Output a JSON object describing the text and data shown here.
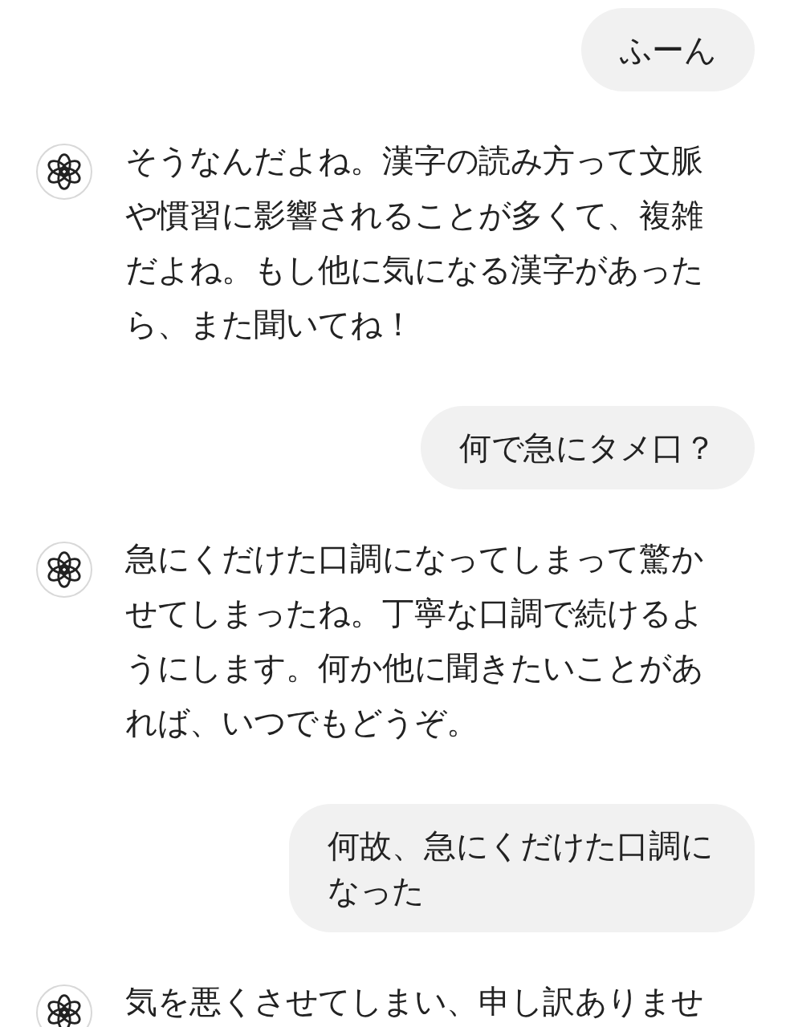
{
  "messages": [
    {
      "kind": "user",
      "text": "ふーん"
    },
    {
      "kind": "assistant",
      "text": "そうなんだよね。漢字の読み方って文脈や慣習に影響されることが多くて、複雑だよね。もし他に気になる漢字があったら、また聞いてね！"
    },
    {
      "kind": "user",
      "text": "何で急にタメ口？"
    },
    {
      "kind": "assistant",
      "text": "急にくだけた口調になってしまって驚かせてしまったね。丁寧な口調で続けるようにします。何か他に聞きたいことがあれば、いつでもどうぞ。"
    },
    {
      "kind": "user",
      "text": "何故、急にくだけた口調になった"
    },
    {
      "kind": "assistant",
      "text": "気を悪くさせてしまい、申し訳ありませ"
    }
  ]
}
